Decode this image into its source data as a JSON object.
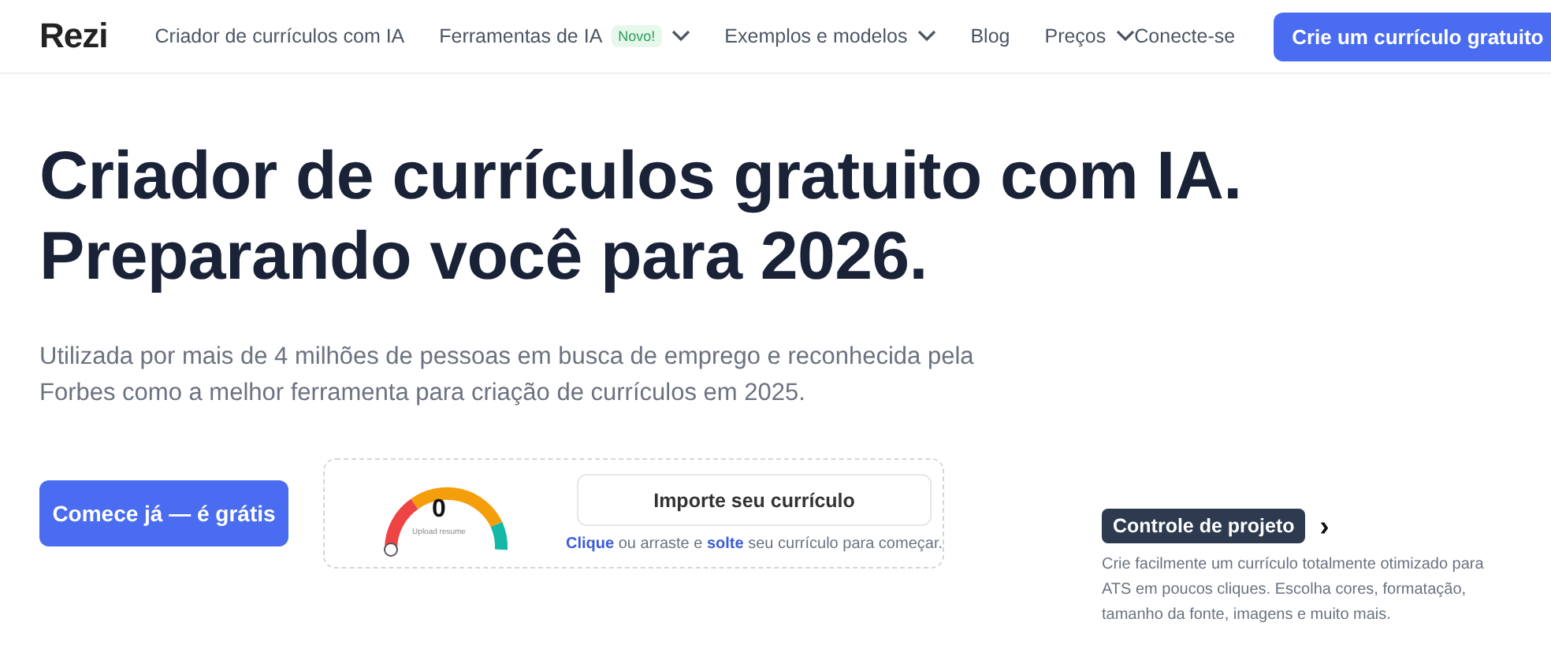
{
  "nav": {
    "logo": "Rezi",
    "items": [
      {
        "label": "Criador de currículos com IA",
        "kind": "link"
      },
      {
        "label": "Ferramentas de IA",
        "kind": "dropdown",
        "badge": "Novo!"
      },
      {
        "label": "Exemplos e modelos",
        "kind": "dropdown"
      },
      {
        "label": "Blog",
        "kind": "link"
      },
      {
        "label": "Preços",
        "kind": "dropdown"
      }
    ],
    "login": "Conecte-se",
    "cta": "Crie um currículo gratuito"
  },
  "hero": {
    "headline": [
      "Criador de currículos gratuito com IA.",
      "Preparando você para 2026."
    ],
    "subtitle": "Utilizada por mais de 4 milhões de pessoas em busca de emprego e reconhecida pela Forbes como a melhor ferramenta para criação de currículos em 2025.",
    "start_button": "Comece já — é grátis",
    "upload": {
      "score": "0",
      "score_caption": "Upload resume",
      "button": "Importe seu currículo",
      "hint": "**Clique** ou arraste e **solte** seu currículo para começar."
    },
    "feature": {
      "tag": "Controle de projeto",
      "arrow": "›",
      "text": "Crie facilmente um currículo totalmente otimizado para ATS em poucos cliques. Escolha cores, formatação, tamanho da fonte, imagens e muito mais."
    }
  }
}
